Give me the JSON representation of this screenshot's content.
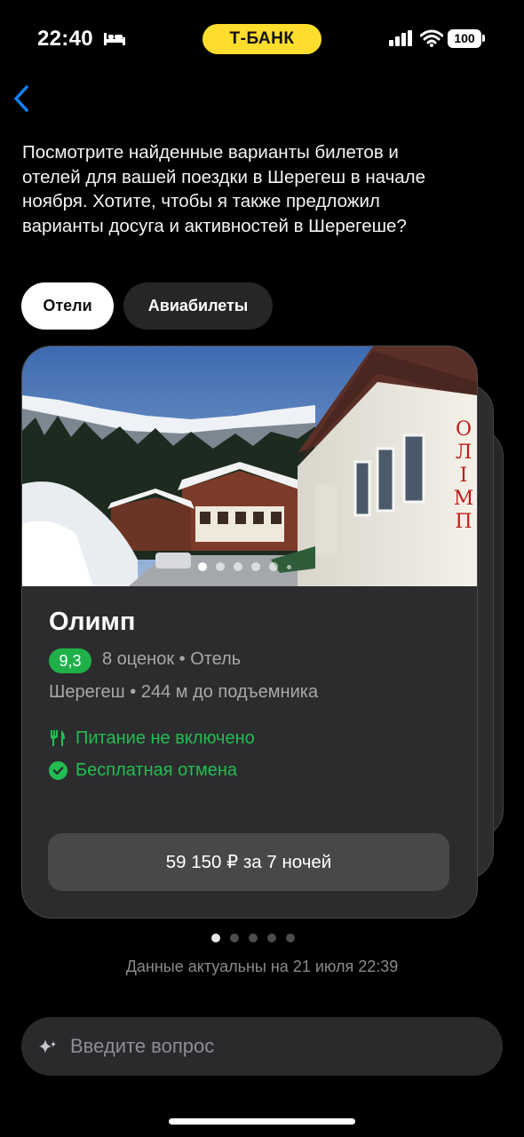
{
  "status_bar": {
    "time": "22:40",
    "brand": "Т-БАНК",
    "battery": "100"
  },
  "message": "Посмотрите найденные варианты билетов и отелей для вашей поездки в Шерегеш в начале ноября. Хотите, чтобы я также предложил варианты досуга и активностей в Шерегеше?",
  "tabs": [
    {
      "label": "Отели",
      "active": true
    },
    {
      "label": "Авиабилеты",
      "active": false
    }
  ],
  "hotel": {
    "name": "Олимп",
    "rating": "9,3",
    "meta": "8 оценок • Отель",
    "location": "Шерегеш • 244 м до подъемника",
    "features": [
      "Питание не включено",
      "Бесплатная отмена"
    ],
    "price": "59 150 ₽ за 7 ночей",
    "sign_text": "ОЛІМП",
    "photo_count": 5,
    "photo_index": 1
  },
  "pager": {
    "count": 5,
    "active": 1
  },
  "updated_text": "Данные актуальны на 21 июля 22:39",
  "input": {
    "placeholder": "Введите вопрос"
  },
  "colors": {
    "brand_yellow": "#ffdd2d",
    "rating_green": "#1fb04a",
    "feature_green": "#22bd51",
    "back_blue": "#0a84ff"
  }
}
